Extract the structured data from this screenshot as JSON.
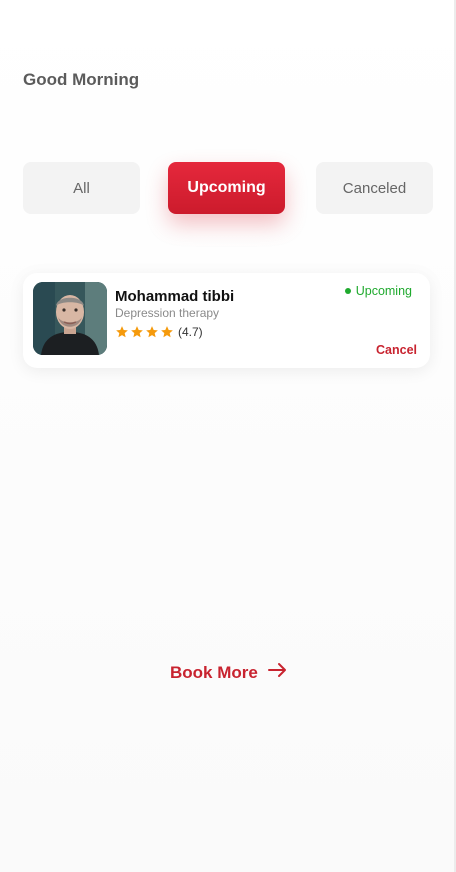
{
  "header": {
    "greeting": "Good Morning"
  },
  "tabs": [
    {
      "label": "All",
      "active": false
    },
    {
      "label": "Upcoming",
      "active": true
    },
    {
      "label": "Canceled",
      "active": false
    }
  ],
  "appointments": [
    {
      "doctor_name": "Mohammad tibbi",
      "specialty": "Depression therapy",
      "stars": 4,
      "rating_text": "(4.7)",
      "status": "Upcoming",
      "cancel_label": "Cancel"
    }
  ],
  "footer": {
    "book_more_label": "Book More",
    "arrow_icon": "arrow-right-icon"
  },
  "colors": {
    "accent": "#d61f30",
    "status_green": "#1faa2e",
    "star": "#f59a0c",
    "tab_inactive_bg": "#f3f3f3"
  }
}
